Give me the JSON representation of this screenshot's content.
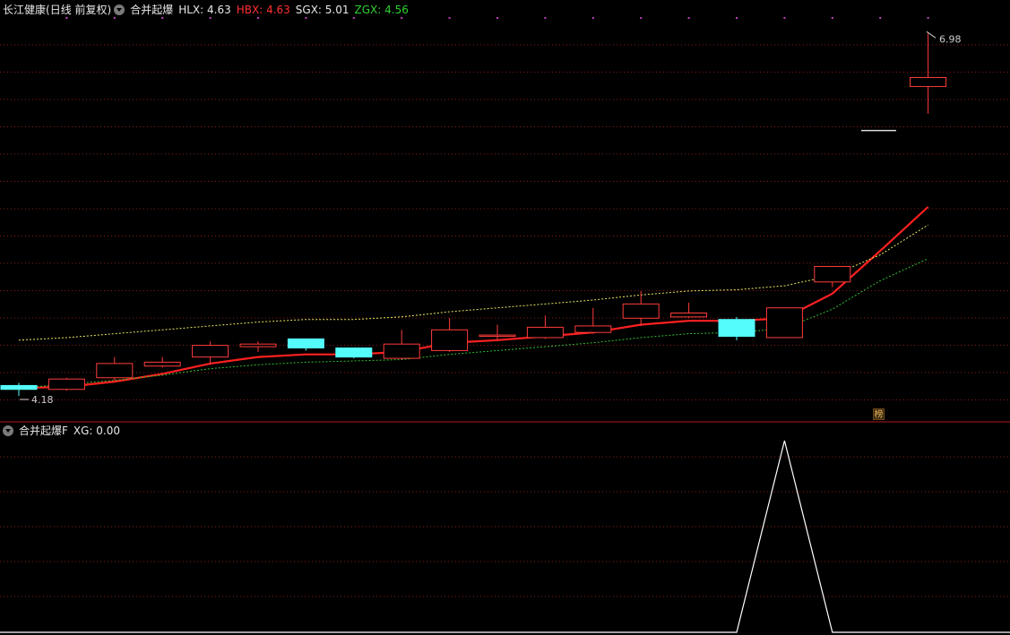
{
  "header": {
    "stock_name": "长江健康",
    "period": "(日线 前复权)",
    "indicator": "合并起爆",
    "hlx": "HLX: 4.63",
    "hbx": "HBX: 4.63",
    "sgx": "SGX: 5.01",
    "zgx": "ZGX: 4.56"
  },
  "sub_header": {
    "indicator": "合并起爆F",
    "xg": "XG: 0.00"
  },
  "badge": "榜",
  "colors": {
    "up": "#ff3c3c",
    "down": "#54fcfc",
    "hlx": "#ff2020",
    "sgx": "#e8e860",
    "zgx": "#30c030",
    "grid": "#8b1a1a",
    "xg": "#ffffff"
  },
  "chart_data": [
    {
      "type": "candlestick",
      "title": "",
      "y_range": [
        4.0,
        7.1
      ],
      "max_label": "6.98",
      "min_label": "4.18",
      "candles": [
        {
          "o": 4.26,
          "c": 4.23,
          "h": 4.28,
          "l": 4.18
        },
        {
          "o": 4.23,
          "c": 4.31,
          "h": 4.32,
          "l": 4.22
        },
        {
          "o": 4.32,
          "c": 4.43,
          "h": 4.48,
          "l": 4.3
        },
        {
          "o": 4.41,
          "c": 4.44,
          "h": 4.48,
          "l": 4.4
        },
        {
          "o": 4.48,
          "c": 4.57,
          "h": 4.6,
          "l": 4.42
        },
        {
          "o": 4.56,
          "c": 4.58,
          "h": 4.6,
          "l": 4.52
        },
        {
          "o": 4.62,
          "c": 4.55,
          "h": 4.62,
          "l": 4.53
        },
        {
          "o": 4.55,
          "c": 4.48,
          "h": 4.55,
          "l": 4.47
        },
        {
          "o": 4.47,
          "c": 4.58,
          "h": 4.69,
          "l": 4.46
        },
        {
          "o": 4.53,
          "c": 4.69,
          "h": 4.78,
          "l": 4.52
        },
        {
          "o": 4.65,
          "c": 4.65,
          "h": 4.73,
          "l": 4.61
        },
        {
          "o": 4.63,
          "c": 4.71,
          "h": 4.8,
          "l": 4.62
        },
        {
          "o": 4.67,
          "c": 4.72,
          "h": 4.86,
          "l": 4.66
        },
        {
          "o": 4.78,
          "c": 4.89,
          "h": 4.99,
          "l": 4.72
        },
        {
          "o": 4.79,
          "c": 4.82,
          "h": 4.9,
          "l": 4.78
        },
        {
          "o": 4.77,
          "c": 4.64,
          "h": 4.79,
          "l": 4.61
        },
        {
          "o": 4.63,
          "c": 4.86,
          "h": 4.86,
          "l": 4.63
        },
        {
          "o": 5.06,
          "c": 5.18,
          "h": 5.18,
          "l": 5.02
        },
        {
          "o": null,
          "c": null,
          "h": null,
          "l": null
        },
        {
          "o": 6.57,
          "c": 6.64,
          "h": 6.98,
          "l": 6.36
        }
      ],
      "series": [
        {
          "key": "HLX",
          "values": [
            4.24,
            4.25,
            4.29,
            4.35,
            4.43,
            4.48,
            4.5,
            4.5,
            4.52,
            4.59,
            4.61,
            4.64,
            4.67,
            4.73,
            4.76,
            4.76,
            4.78,
            4.97,
            5.3,
            5.64
          ]
        },
        {
          "key": "SGX",
          "values": [
            4.61,
            4.63,
            4.66,
            4.69,
            4.72,
            4.75,
            4.77,
            4.77,
            4.79,
            4.83,
            4.86,
            4.89,
            4.92,
            4.96,
            4.99,
            5.0,
            5.03,
            5.11,
            5.27,
            5.5
          ]
        },
        {
          "key": "ZGX",
          "values": [
            4.24,
            4.27,
            4.3,
            4.34,
            4.39,
            4.42,
            4.44,
            4.45,
            4.46,
            4.5,
            4.53,
            4.56,
            4.59,
            4.63,
            4.66,
            4.67,
            4.7,
            4.85,
            5.07,
            5.24
          ]
        }
      ],
      "flat_line_value": 6.23
    },
    {
      "type": "line",
      "title": "",
      "series": [
        {
          "key": "XG",
          "values": [
            0,
            0,
            0,
            0,
            0,
            0,
            0,
            0,
            0,
            0,
            0,
            0,
            0,
            0,
            0,
            0,
            1,
            0,
            0,
            0
          ]
        }
      ]
    }
  ]
}
